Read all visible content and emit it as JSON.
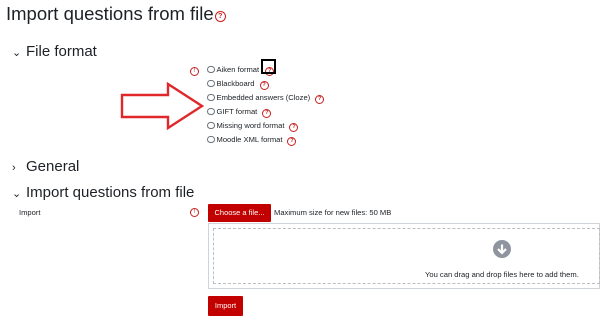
{
  "page": {
    "title": "Import questions from file",
    "title_help": "?"
  },
  "sections": {
    "file_format": {
      "label": "File format",
      "expanded": true
    },
    "general": {
      "label": "General",
      "expanded": false
    },
    "import_questions": {
      "label": "Import questions from file",
      "expanded": true
    }
  },
  "file_format": {
    "required_icon": "!",
    "options": [
      {
        "label": "Aiken format",
        "help": "?"
      },
      {
        "label": "Blackboard",
        "help": "?"
      },
      {
        "label": "Embedded answers (Cloze)",
        "help": "?"
      },
      {
        "label": "GIFT format",
        "help": "?"
      },
      {
        "label": "Missing word format",
        "help": "?"
      },
      {
        "label": "Moodle XML format",
        "help": "?"
      }
    ]
  },
  "import": {
    "label": "Import",
    "required_icon": "!",
    "choose_file_label": "Choose a file...",
    "max_size_text": "Maximum size for new files: 50 MB",
    "drop_hint": "You can drag and drop files here to add them.",
    "import_button_label": "Import"
  },
  "icons": {
    "chevron_down": "chevron-down-icon",
    "chevron_right": "chevron-right-icon",
    "download": "download-arrow-icon",
    "annotation_arrow": "red-outline-arrow"
  },
  "colors": {
    "accent_red": "#c30000",
    "text": "#1d2125",
    "icon_grey": "#8f959e"
  }
}
